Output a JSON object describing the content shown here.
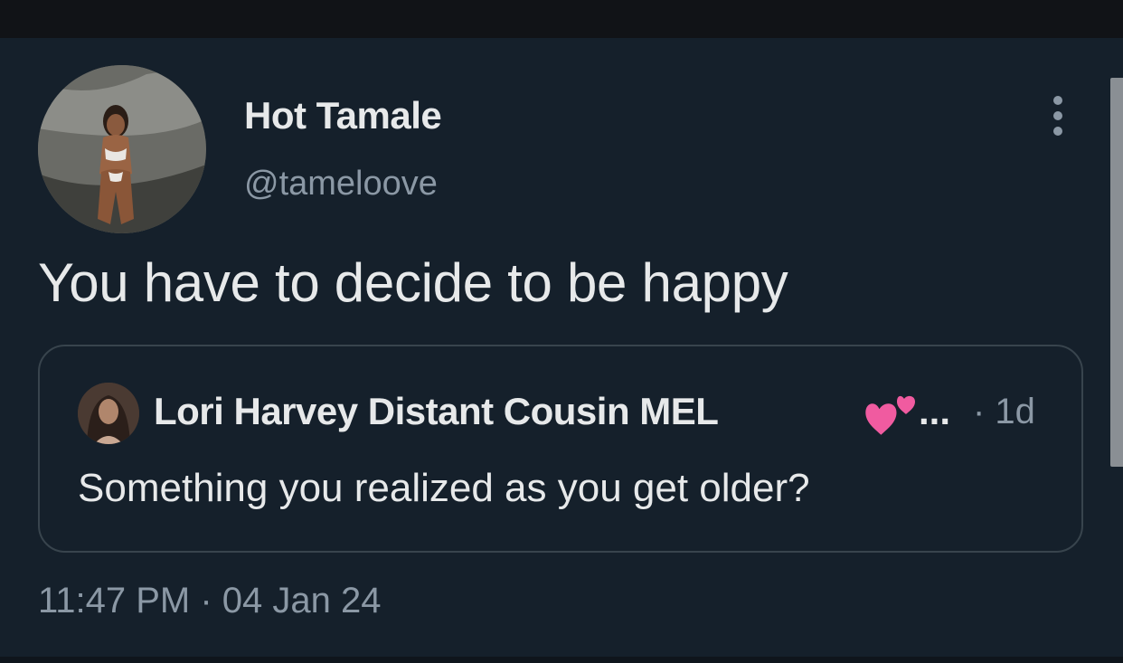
{
  "tweet": {
    "author": {
      "display_name": "Hot Tamale",
      "handle": "@tameloove"
    },
    "text": "You have to decide to be happy",
    "timestamp": "11:47 PM · 04 Jan 24"
  },
  "quoted_tweet": {
    "author": {
      "display_name": "Lori Harvey Distant Cousin MEL",
      "name_emoji": "two-hearts-icon",
      "truncation": "..."
    },
    "age": "· 1d",
    "text": "Something you realized as you get older?"
  },
  "colors": {
    "background": "#15202b",
    "primary_text": "#e7e9ea",
    "secondary_text": "#8b98a5",
    "card_border": "#38444d",
    "heart": "#f05ba0"
  },
  "icons": {
    "more": "more-vertical-icon"
  }
}
